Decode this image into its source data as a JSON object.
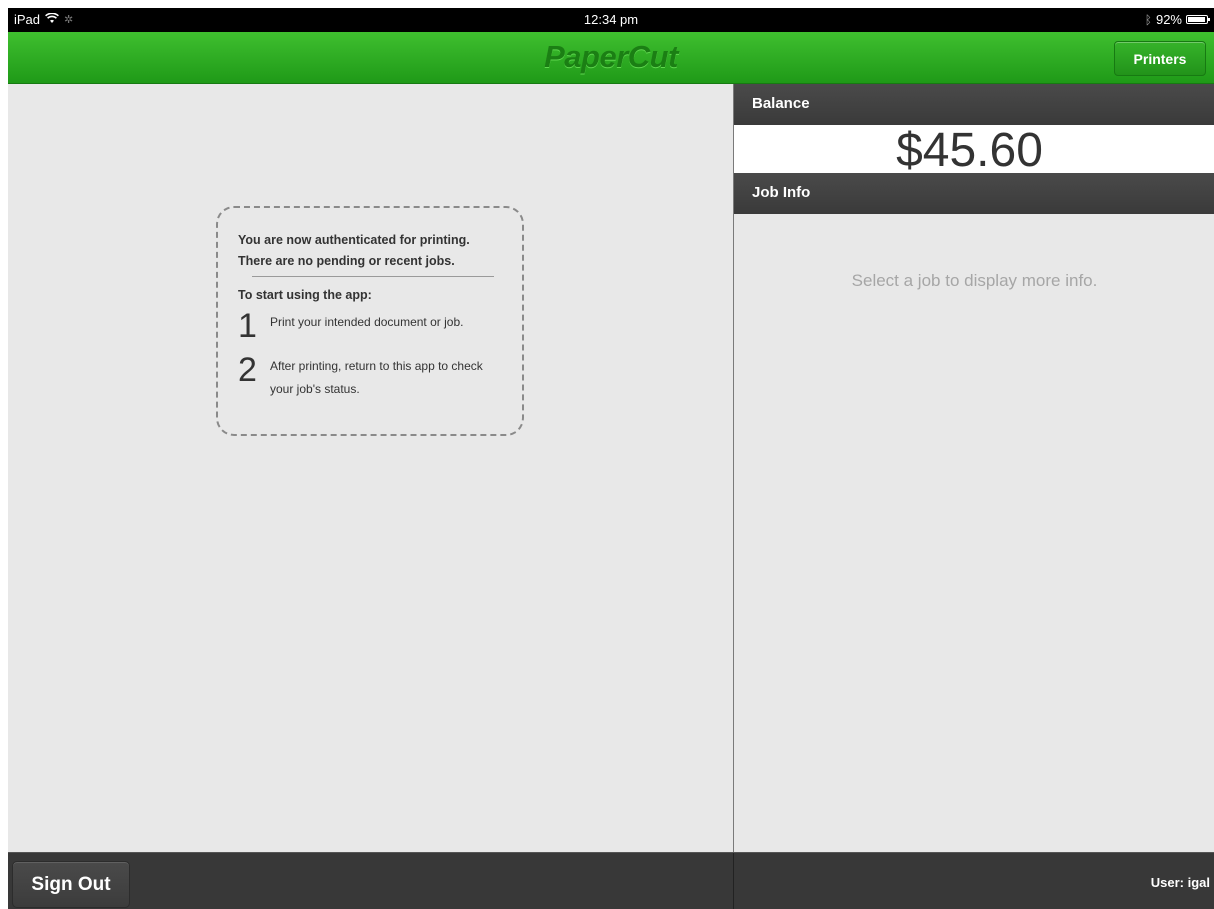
{
  "status_bar": {
    "device": "iPad",
    "time": "12:34 pm",
    "battery": "92%",
    "battery_level": 0.92
  },
  "header": {
    "brand": "PaperCut",
    "printers_label": "Printers"
  },
  "instructions": {
    "line1": "You are now authenticated for printing.",
    "line2": "There are no pending or recent jobs.",
    "start_label": "To start using the app:",
    "steps": [
      {
        "number": "1",
        "text": "Print your intended document or job."
      },
      {
        "number": "2",
        "text_line1": "After printing, return to this app to check",
        "text_line2": "your job's status."
      }
    ]
  },
  "balance": {
    "label": "Balance",
    "value": "$45.60"
  },
  "job_info": {
    "label": "Job Info",
    "empty_message": "Select a job to display more info."
  },
  "footer": {
    "sign_out_label": "Sign Out",
    "user_label": "User: igal"
  },
  "colors": {
    "header_green": "#2fae22",
    "brand_text": "#1b7f14",
    "dark_bar": "#383838",
    "panel_bg": "#e8e8e8"
  }
}
